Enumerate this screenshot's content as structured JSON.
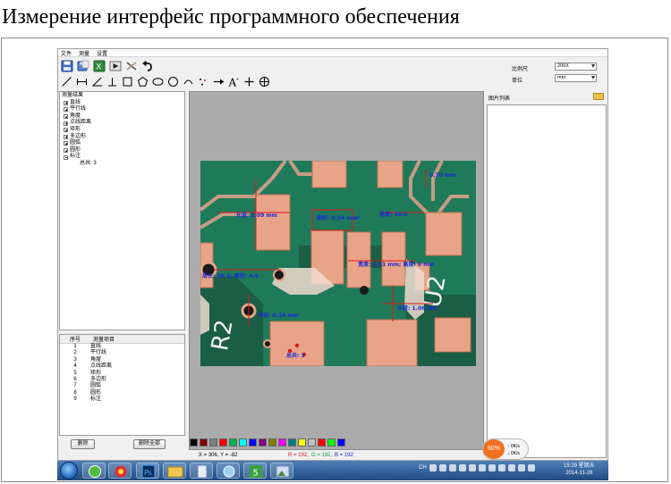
{
  "slide_title": "Измерение интерфейс программного обеспечения",
  "menu": [
    "文件",
    "测量",
    "设置"
  ],
  "scale": {
    "label": "比例尺",
    "value": "200X"
  },
  "unit": {
    "label": "单位",
    "value": "mm"
  },
  "tree": {
    "root": "测量结果",
    "items": [
      "直线",
      "平行线",
      "角度",
      "点线距离",
      "矩形",
      "多边形",
      "圆弧",
      "圆形"
    ],
    "expanded": "标注",
    "child": "总共: 3"
  },
  "list": {
    "col_no": "序号",
    "col_item": "测量项目",
    "rows": [
      {
        "no": "1",
        "item": "直线"
      },
      {
        "no": "2",
        "item": "平行线"
      },
      {
        "no": "3",
        "item": "角度"
      },
      {
        "no": "4",
        "item": "点线距离"
      },
      {
        "no": "5",
        "item": "矩形"
      },
      {
        "no": "6",
        "item": "多边形"
      },
      {
        "no": "7",
        "item": "圆弧"
      },
      {
        "no": "8",
        "item": "圆形"
      },
      {
        "no": "9",
        "item": "标注"
      }
    ]
  },
  "image_list_label": "图片列表",
  "buttons": {
    "delete": "删除",
    "delete_all": "删除全部"
  },
  "swatches": [
    "#000000",
    "#7f0000",
    "#7f7f7f",
    "#ff0000",
    "#00b050",
    "#00ffff",
    "#0000ff",
    "#7f007f",
    "#7f7f00",
    "#ff00ff",
    "#007f7f",
    "#ffff00",
    "#c0c0c0",
    "#ff0000",
    "#00ff00",
    "#0000ff"
  ],
  "status": {
    "coords": "X = 306, Y = -82",
    "r": "R = 192,",
    "g": "G = 192,",
    "b": "B = 192"
  },
  "annotations": {
    "line": "长度: 2.09 mm",
    "area1": "面积: 0.54 mm²",
    "angle": "角度: 48.0",
    "radius": "0.70 mm",
    "rect": "宽度: 1.51 mm; 高度: 0 mm",
    "dist": "长度: 1.06 mm",
    "polygon": "周长: 30.4; 面积: 4.6",
    "circle": "半径: 0.16 mm",
    "note": "总共: 3"
  },
  "board_text": {
    "r2": "R2",
    "u2": "U2"
  },
  "network": {
    "percent": "60%",
    "up": "0K/s",
    "down": "0K/s"
  },
  "taskbar": {
    "lang": "CH",
    "time": "15:29 星期五",
    "date": "2014-11-28"
  },
  "colors": {
    "annotation_blue": "#1a2ad8",
    "annotation_red": "#e01818",
    "pcb_green": "#1f7a5a",
    "pad_copper": "#d98a70"
  }
}
